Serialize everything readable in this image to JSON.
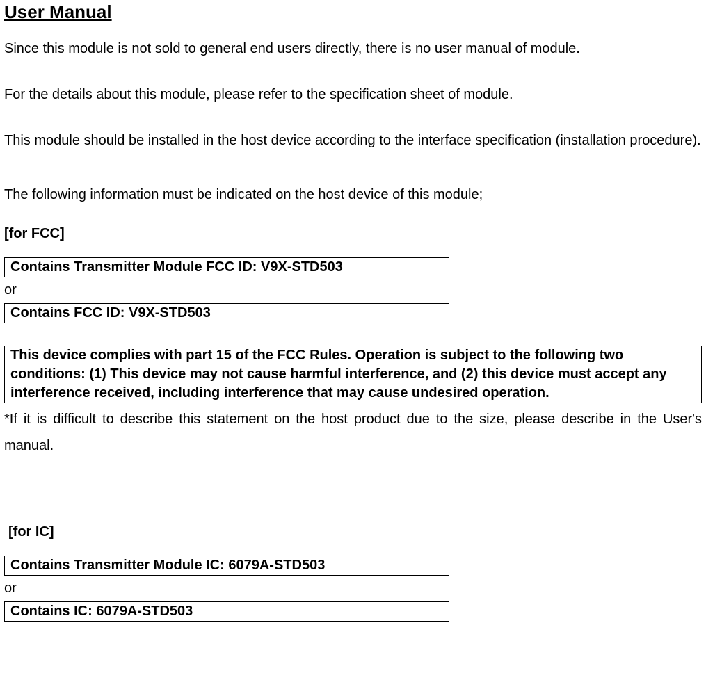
{
  "title": "User Manual",
  "para1": "Since this module is not sold to general end users directly, there is no user manual of module.",
  "para2": "For the details about this module, please refer to the specification sheet of module.",
  "para3": "This module should be installed in the host device according to the interface specification (installation procedure).",
  "lead": "The following information must be indicated on the host device of this module;",
  "fcc": {
    "label": "[for FCC]",
    "box1": "Contains Transmitter Module FCC ID: V9X-STD503",
    "or": "or",
    "box2": "Contains FCC ID: V9X-STD503",
    "statement": "This device complies with part 15 of the FCC Rules. Operation is subject to the following two conditions: (1) This device may not cause harmful interference, and (2) this device must accept any interference received, including interference that may cause undesired operation.",
    "note": "*If it is difficult to describe this statement on the host product due to the size, please describe in the User's manual."
  },
  "ic": {
    "label": "[for IC]",
    "box1": "Contains Transmitter Module IC: 6079A-STD503",
    "or": "or",
    "box2": "Contains IC: 6079A-STD503"
  }
}
